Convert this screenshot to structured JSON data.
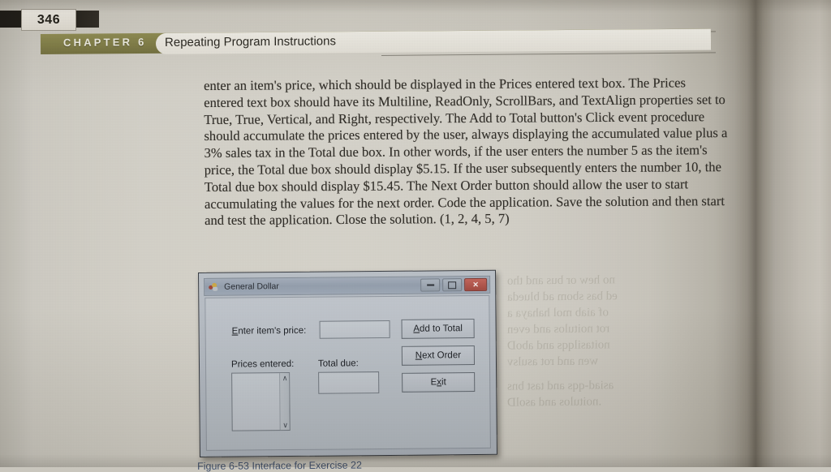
{
  "page": {
    "number": "346",
    "chapter_label": "CHAPTER 6",
    "chapter_title": "Repeating Program Instructions"
  },
  "body": {
    "paragraph": "enter an item's price, which should be displayed in the Prices entered text box. The Prices entered text box should have its Multiline, ReadOnly, ScrollBars, and TextAlign properties set to True, True, Vertical, and Right, respectively. The Add to Total button's Click event procedure should accumulate the prices entered by the user, always displaying the accumulated value plus a 3% sales tax in the Total due box. In other words, if the user enters the number 5 as the item's price, the Total due box should display $5.15. If the user subsequently enters the number 10, the Total due box should display $15.45. The Next Order button should allow the user to start accumulating the values for the next order. Code the application. Save the solution and then start and test the application. Close the solution. (1, 2, 4, 5, 7)"
  },
  "showthrough": {
    "line1": "no hew or bus and tho",
    "line2": "ed bas sbom ad blueda",
    "line3": "of aiab mol hahaya a",
    "line4": "rot noitulos and even",
    "line5": "noitasilqqs and aboD",
    "line6": "wen and rot asulsv",
    "line7": "asiad-qqs and tast bns",
    "line8": ".noitulos and asolD"
  },
  "form": {
    "title": "General Dollar",
    "icon": "vb-form-icon",
    "window_buttons": {
      "minimize": "minimize-button",
      "maximize": "maximize-button",
      "close": "✕"
    },
    "price_label_pre": "",
    "price_label_key": "E",
    "price_label_post": "nter item's price:",
    "price_value": "",
    "prices_label": "Prices entered:",
    "prices_value": "",
    "total_label": "Total due:",
    "total_value": "",
    "add_btn_key": "A",
    "add_btn_post": "dd to Total",
    "next_btn_key": "N",
    "next_btn_post": "ext Order",
    "exit_btn_pre": "E",
    "exit_btn_key": "x",
    "exit_btn_post": "it",
    "scroll_up": "∧",
    "scroll_down": "∨"
  },
  "caption": {
    "text": "Figure 6-53    Interface for Exercise 22"
  },
  "colors": {
    "chapter_bar": "#7d7a42",
    "page_paper": "#d2cfc6",
    "form_chrome": "#b2b9c1",
    "title_bar": "#8e99a8",
    "close_button": "#9d4036",
    "body_text": "#25221c"
  }
}
